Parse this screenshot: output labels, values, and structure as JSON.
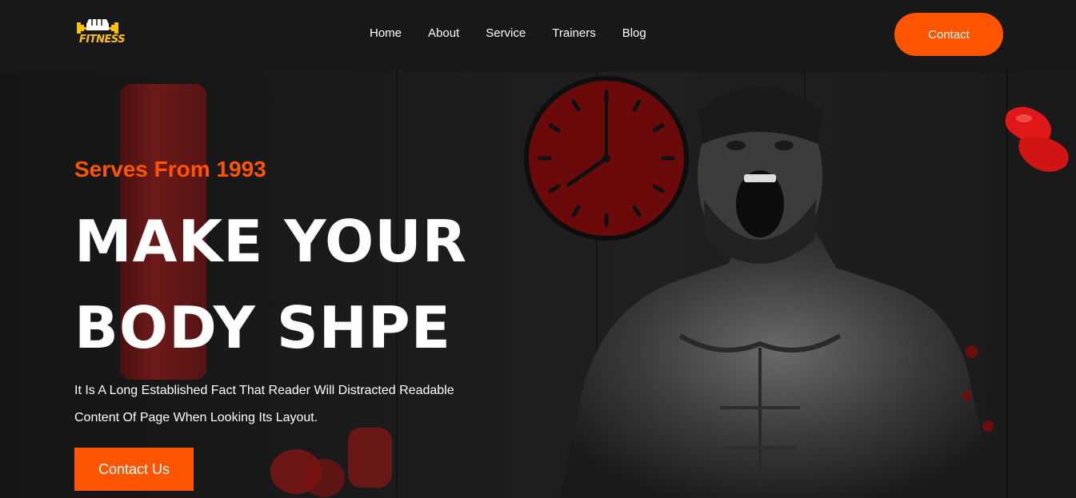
{
  "brand": {
    "logo_text": "FITNESS",
    "accent_color": "#ff5500",
    "logo_color": "#ffc107"
  },
  "nav": {
    "items": [
      {
        "label": "Home"
      },
      {
        "label": "About"
      },
      {
        "label": "Service"
      },
      {
        "label": "Trainers"
      },
      {
        "label": "Blog"
      }
    ],
    "contact_label": "Contact"
  },
  "hero": {
    "tagline": "Serves From 1993",
    "headline_line1": "MAKE YOUR",
    "headline_line2": "BODY SHPE",
    "description": "It Is A Long Established Fact That Reader Will Distracted Readable Content Of Page When Looking Its Layout.",
    "cta_label": "Contact Us"
  },
  "icons": {
    "logo": "dumbbell-fist-icon",
    "clock": "wall-clock-icon",
    "gloves": "boxing-gloves-icon",
    "bag": "punching-bag-icon"
  }
}
